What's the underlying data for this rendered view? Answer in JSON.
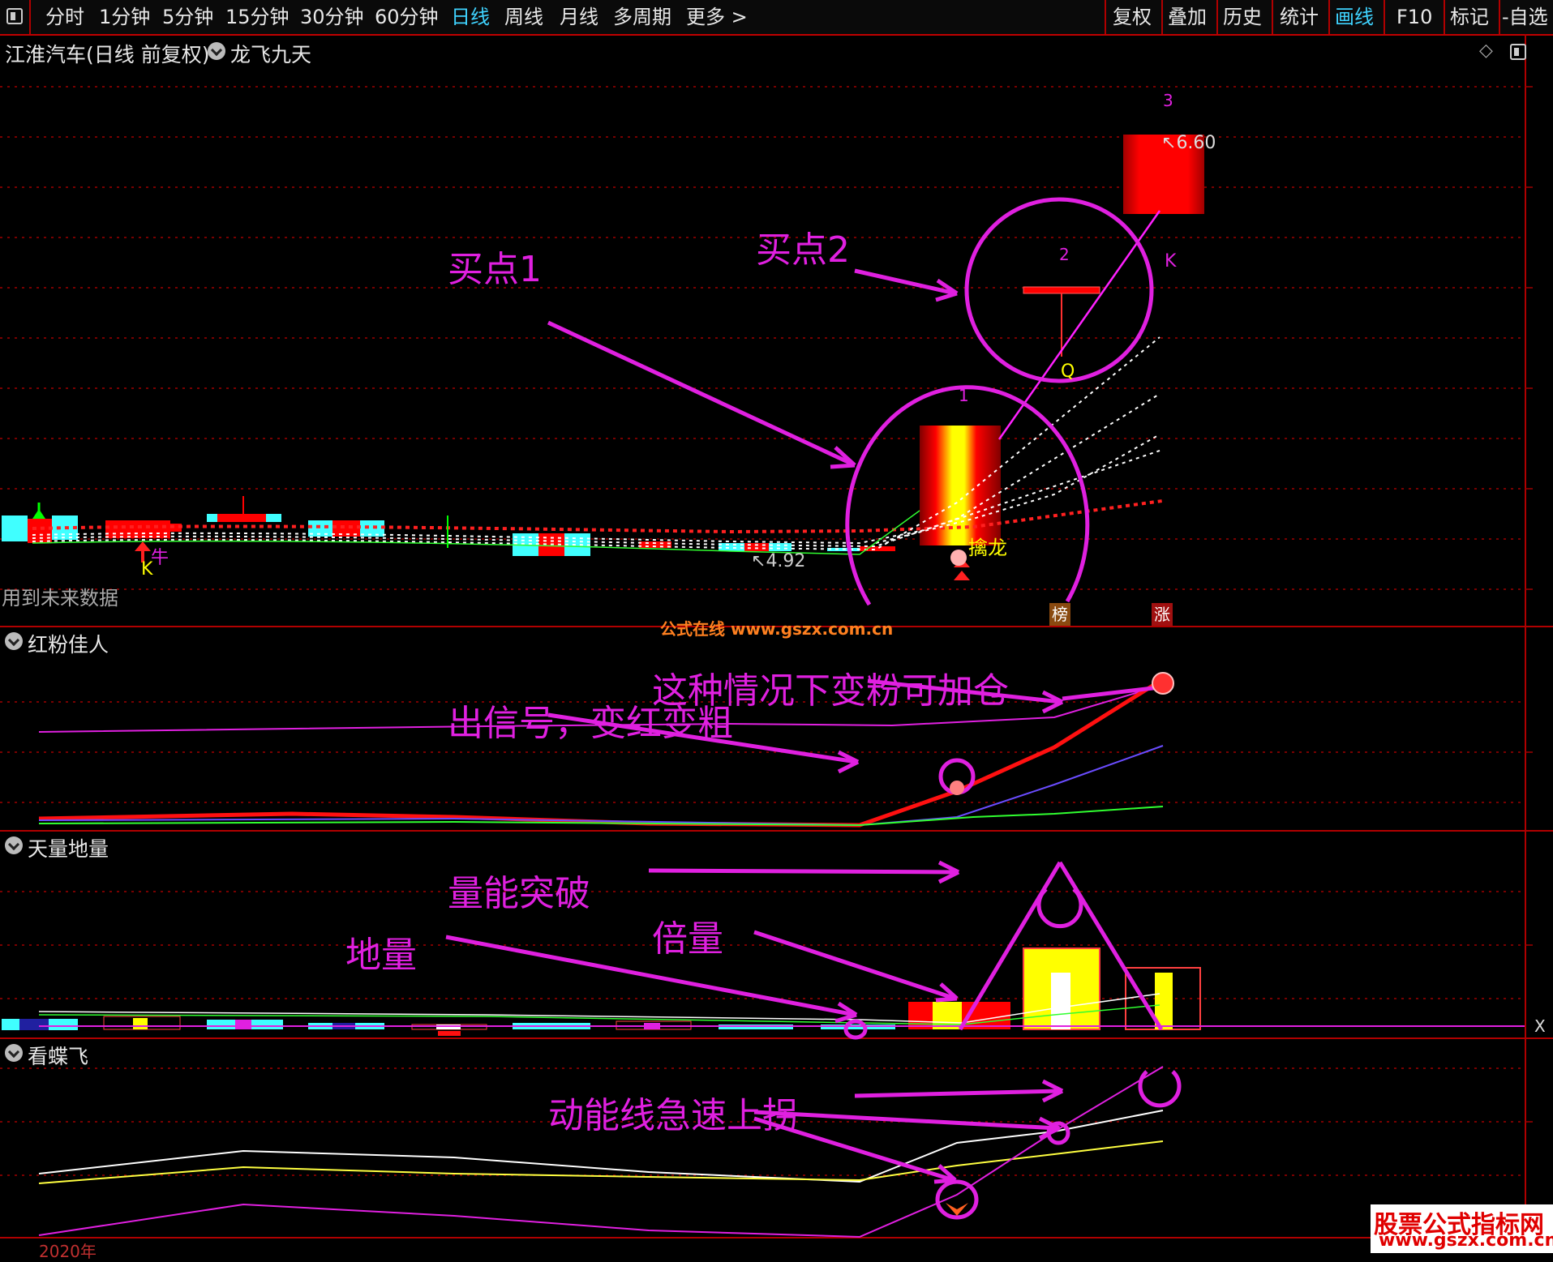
{
  "toolbar": {
    "periods": [
      "分时",
      "1分钟",
      "5分钟",
      "15分钟",
      "30分钟",
      "60分钟",
      "日线",
      "周线",
      "月线",
      "多周期",
      "更多 >"
    ],
    "active_period": "日线",
    "tools": [
      "复权",
      "叠加",
      "历史",
      "统计",
      "画线",
      "F10",
      "标记",
      "-自选"
    ],
    "active_tool": "画线"
  },
  "main": {
    "title": "江淮汽车(日线 前复权)",
    "indicator": "龙飞九天",
    "future_note": "用到未来数据",
    "high_label": "6.60",
    "low_label": "4.92",
    "marker_labels": [
      "1",
      "2",
      "3"
    ],
    "signal_labels": {
      "k1": "K",
      "k2": "K",
      "niu": "牛",
      "q": "Q",
      "qinlong": "擒龙"
    },
    "bottom_badges": [
      "榜",
      "涨"
    ],
    "watermark_center": "公式在线  www.gszx.com.cn",
    "annotations": {
      "buy1": "买点1",
      "buy2": "买点2"
    }
  },
  "panel1": {
    "title": "红粉佳人",
    "annotations": {
      "a": "这种情况下变粉可加仓",
      "b": "出信号，变红变粗"
    }
  },
  "panel2": {
    "title": "天量地量",
    "annotations": {
      "a": "量能突破",
      "b": "倍量",
      "c": "地量"
    },
    "axis_mark": "X"
  },
  "panel3": {
    "title": "看蝶飞",
    "annotations": {
      "a": "动能线急速上拐"
    },
    "year_label": "2020年"
  },
  "watermark": {
    "line1": "股票公式指标网",
    "line2": "www.gszx.com.cn"
  },
  "colors": {
    "accent": "#c00000",
    "annotation": "#e020e0",
    "active": "#3fd3ff",
    "cyan": "#40ffff",
    "yellow": "#ffff00",
    "red": "#ff0000"
  }
}
